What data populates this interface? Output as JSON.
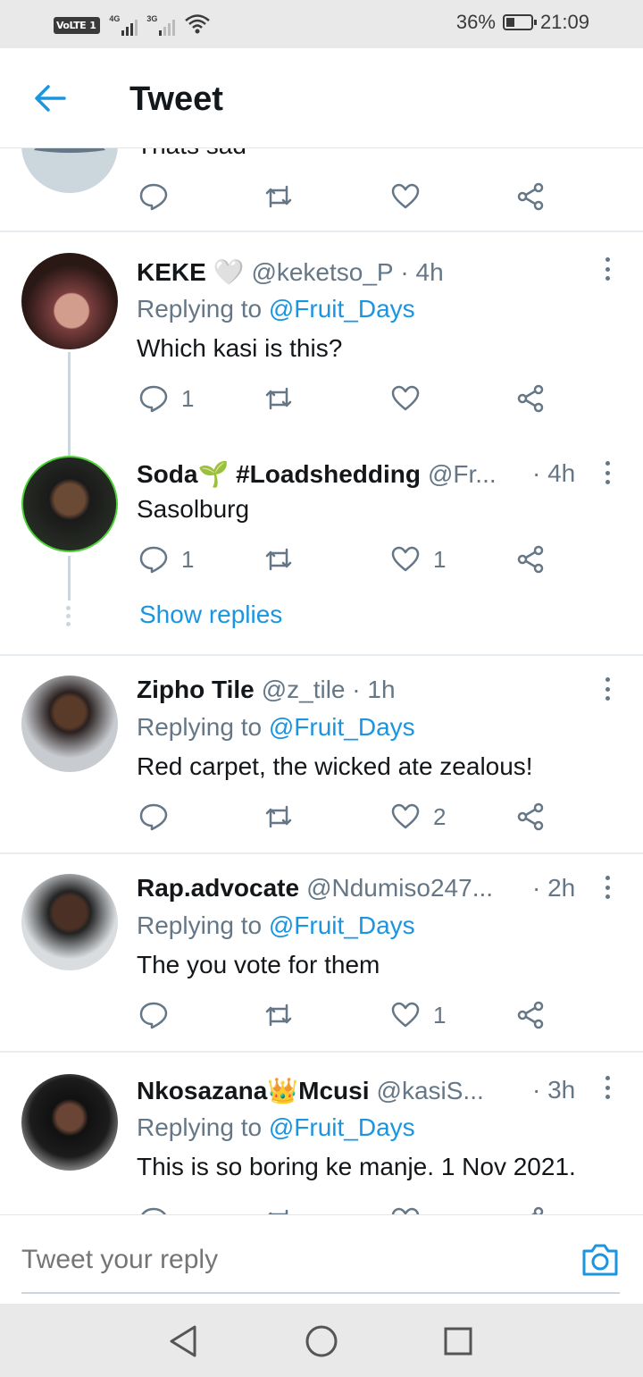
{
  "status_bar": {
    "volte": "VoLTE",
    "sim": "1",
    "net1": "4G",
    "net2": "3G",
    "battery": "36%",
    "battery_level": 0.36,
    "time": "21:09"
  },
  "header": {
    "title": "Tweet",
    "back_icon": "arrow-left-icon"
  },
  "partial_tweet": {
    "text": "Thats sad"
  },
  "tweets": [
    {
      "name": "KEKE 🤍",
      "handle": "@keketso_P",
      "time": "4h",
      "replying_prefix": "Replying to",
      "replying_to": "@Fruit_Days",
      "text": "Which kasi is this?",
      "replies": "1",
      "retweets": "",
      "likes": ""
    },
    {
      "name": "Soda🌱 #Loadshedding",
      "handle": "@Fr...",
      "time": "4h",
      "text": "Sasolburg",
      "replies": "1",
      "retweets": "",
      "likes": "1",
      "show_replies": "Show replies"
    },
    {
      "name": "Zipho Tile",
      "handle": "@z_tile",
      "time": "1h",
      "replying_prefix": "Replying to",
      "replying_to": "@Fruit_Days",
      "text": "Red carpet, the wicked ate zealous!",
      "replies": "",
      "retweets": "",
      "likes": "2"
    },
    {
      "name": "Rap.advocate",
      "handle": "@Ndumiso247...",
      "time": "2h",
      "replying_prefix": "Replying to",
      "replying_to": "@Fruit_Days",
      "text": "The you vote for them",
      "replies": "",
      "retweets": "",
      "likes": "1"
    },
    {
      "name": "Nkosazana👑Mcusi",
      "handle": "@kasiS...",
      "time": "3h",
      "replying_prefix": "Replying to",
      "replying_to": "@Fruit_Days",
      "text": "This is so boring ke manje. 1 Nov 2021.",
      "replies": "",
      "retweets": "",
      "likes": ""
    }
  ],
  "reply_bar": {
    "placeholder": "Tweet your reply",
    "camera_icon": "camera-icon"
  },
  "colors": {
    "accent": "#1b95e0",
    "secondary_text": "#657786",
    "primary_text": "#14171a",
    "divider": "#e6ecf0"
  }
}
